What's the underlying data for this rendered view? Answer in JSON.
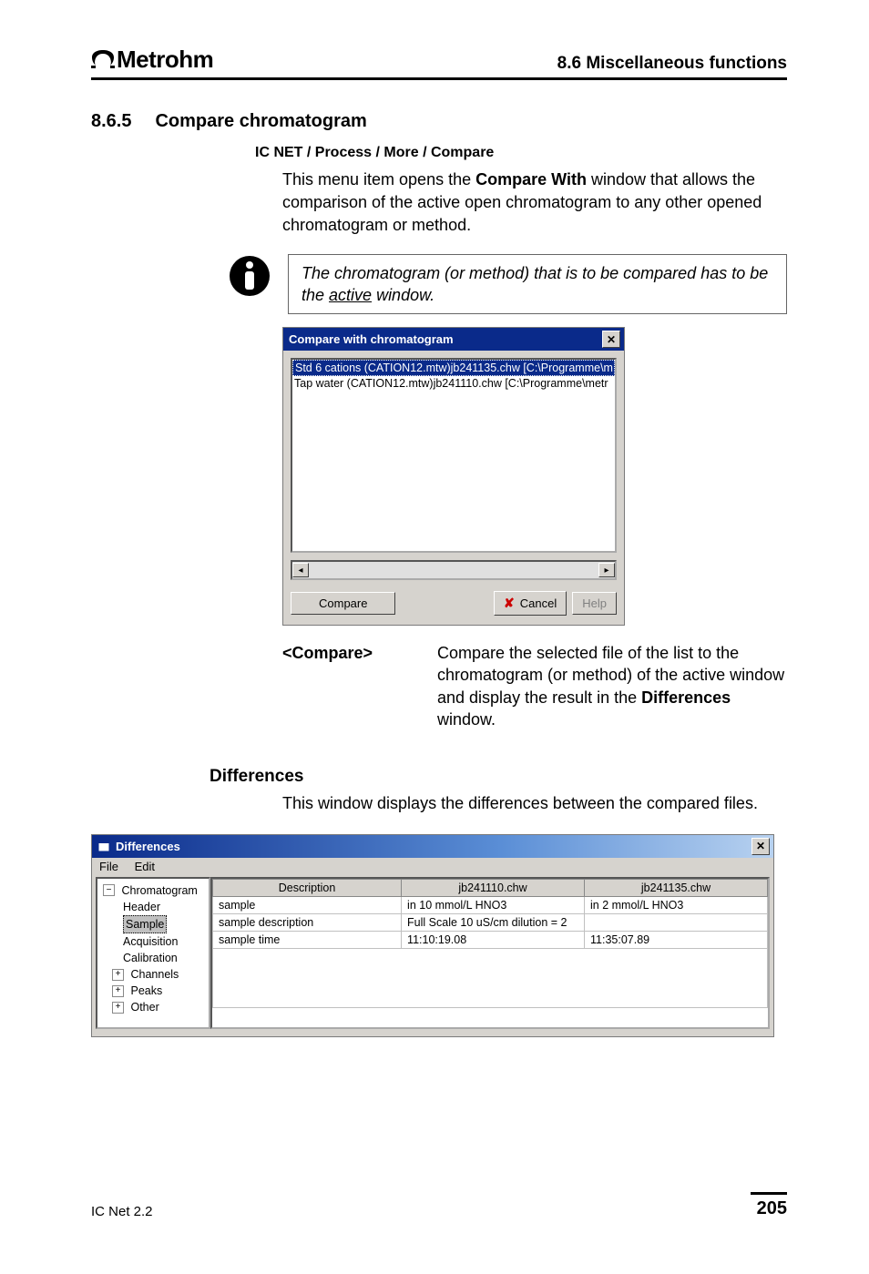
{
  "header": {
    "brand": "Metrohm",
    "section": "8.6  Miscellaneous functions"
  },
  "heading": {
    "num": "8.6.5",
    "title": "Compare chromatogram"
  },
  "menupath": {
    "prefix": "IC NET / ",
    "p": "Process",
    "sep": " / ",
    "m": "More",
    "c": "Compare"
  },
  "para1a": "This menu item opens the ",
  "para1_bold": "Compare With",
  "para1b": " window that allows the comparison of the active open chromatogram to any other opened chromatogram or method.",
  "note_a": "The chromatogram (or method) that is to be compared has to be the ",
  "note_u": "active",
  "note_b": " window.",
  "dialog1": {
    "title": "Compare with chromatogram",
    "item_sel": "Std 6 cations (CATION12.mtw)jb241135.chw   [C:\\Programme\\m",
    "item2": "Tap water (CATION12.mtw)jb241110.chw   [C:\\Programme\\metr",
    "compare": "Compare",
    "cancel": "Cancel",
    "help": "Help"
  },
  "desc": {
    "label": "<Compare>",
    "text_a": "Compare the selected file of the list to the chromatogram (or method) of the active window and display the result in the ",
    "text_bold": "Differ­ences",
    "text_b": " window."
  },
  "diff": {
    "heading": "Differences",
    "intro": "This window displays the differences between the compared files.",
    "title": "Differences",
    "menu_file": "File",
    "menu_edit": "Edit",
    "tree": {
      "root": "Chromatogram",
      "n1": "Header",
      "n2": "Sample",
      "n3": "Acquisition",
      "n4": "Calibration",
      "n5": "Channels",
      "n6": "Peaks",
      "n7": "Other"
    },
    "cols": {
      "c1": "Description",
      "c2": "jb241110.chw",
      "c3": "jb241135.chw"
    },
    "rows": [
      {
        "d": "sample",
        "a": "in 10 mmol/L HNO3",
        "b": "in 2 mmol/L HNO3"
      },
      {
        "d": "sample description",
        "a": "Full Scale 10 uS/cm dilution = 2",
        "b": ""
      },
      {
        "d": "sample time",
        "a": "11:10:19.08",
        "b": "11:35:07.89"
      }
    ]
  },
  "footer": {
    "prod": "IC Net 2.2",
    "page": "205"
  }
}
